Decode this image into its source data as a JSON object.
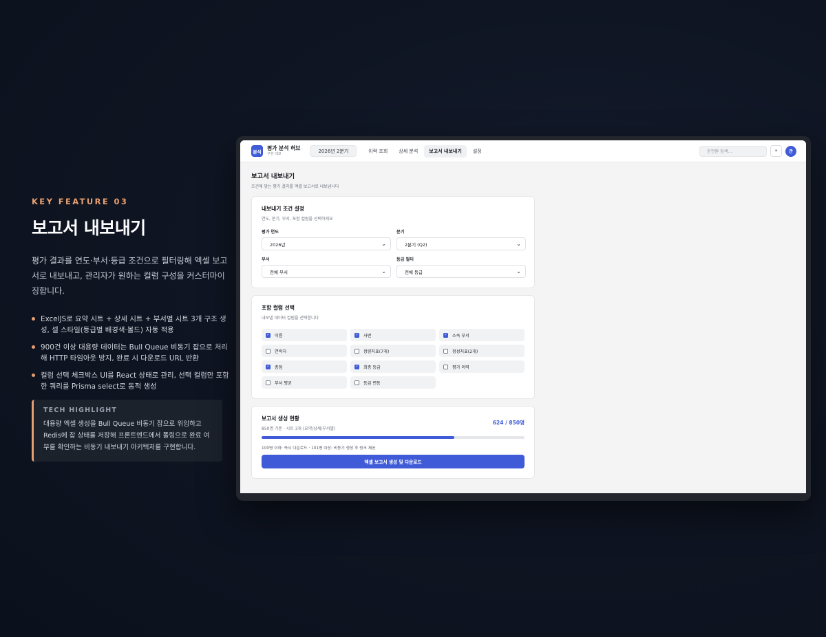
{
  "promo": {
    "eyebrow": "KEY FEATURE 03",
    "title": "보고서 내보내기",
    "description": "평가 결과를 연도·부서·등급 조건으로 필터링해 엑셀 보고서로 내보내고, 관리자가 원하는 컬럼 구성을 커스터마이징합니다.",
    "bullets": [
      "ExcelJS로 요약 시트 + 상세 시트 + 부서별 시트 3개 구조 생성, 셀 스타일(등급별 배경색·볼드) 자동 적용",
      "900건 이상 대용량 데이터는 Bull Queue 비동기 잡으로 처리해 HTTP 타임아웃 방지, 완료 시 다운로드 URL 반환",
      "컬럼 선택 체크박스 UI를 React 상태로 관리, 선택 컬럼만 포함한 쿼리를 Prisma select로 동적 생성"
    ],
    "highlight_title": "TECH HIGHLIGHT",
    "highlight_body": "대용량 엑셀 생성을 Bull Queue 비동기 잡으로 위임하고 Redis에 잡 상태를 저장해 프론트엔드에서 폴링으로 완료 여부를 확인하는 비동기 내보내기 아키텍처를 구현합니다."
  },
  "app": {
    "logo_text": "분석",
    "brand_name": "평가 분석 허브",
    "brand_sub": "구현 데모",
    "period": "2026년 2분기",
    "nav": [
      "이력 조회",
      "상세 분석",
      "보고서 내보내기",
      "설정"
    ],
    "active_nav": "보고서 내보내기",
    "search_placeholder": "운전원 검색...",
    "icon_button": "*",
    "avatar": "관",
    "page_title": "보고서 내보내기",
    "page_sub": "조건에 맞는 평가 결과를 엑셀 보고서로 내보냅니다",
    "conditions": {
      "title": "내보내기 조건 설정",
      "sub": "연도, 분기, 부서, 포함 컬럼을 선택하세요",
      "fields": [
        {
          "label": "평가 연도",
          "value": "2026년"
        },
        {
          "label": "분기",
          "value": "2분기 (Q2)"
        },
        {
          "label": "부서",
          "value": "전체 부서"
        },
        {
          "label": "등급 필터",
          "value": "전체 등급"
        }
      ]
    },
    "columns": {
      "title": "포함 컬럼 선택",
      "sub": "내보낼 데이터 컬럼을 선택합니다",
      "items": [
        {
          "label": "이름",
          "checked": true
        },
        {
          "label": "사번",
          "checked": true
        },
        {
          "label": "소속 부서",
          "checked": true
        },
        {
          "label": "연락처",
          "checked": false
        },
        {
          "label": "정량지표(7개)",
          "checked": false
        },
        {
          "label": "정성지표(2개)",
          "checked": false
        },
        {
          "label": "총점",
          "checked": true
        },
        {
          "label": "최종 등급",
          "checked": true
        },
        {
          "label": "평가 이력",
          "checked": false
        },
        {
          "label": "부서 평균",
          "checked": false
        },
        {
          "label": "등급 변동",
          "checked": false
        }
      ]
    },
    "status": {
      "title": "보고서 생성 현황",
      "sub": "850명 기준 · 시트 3개 (요약/상세/부서별)",
      "count": "624 / 850명",
      "progress": 0.734,
      "note": "100명 이하: 즉시 다운로드 · 101명 이상: 비동기 생성 후 링크 제공",
      "button": "엑셀 보고서 생성 및 다운로드"
    }
  },
  "colors": {
    "accent": "#3f5bd8",
    "highlight": "#e8a070",
    "background": "#0e1421"
  }
}
